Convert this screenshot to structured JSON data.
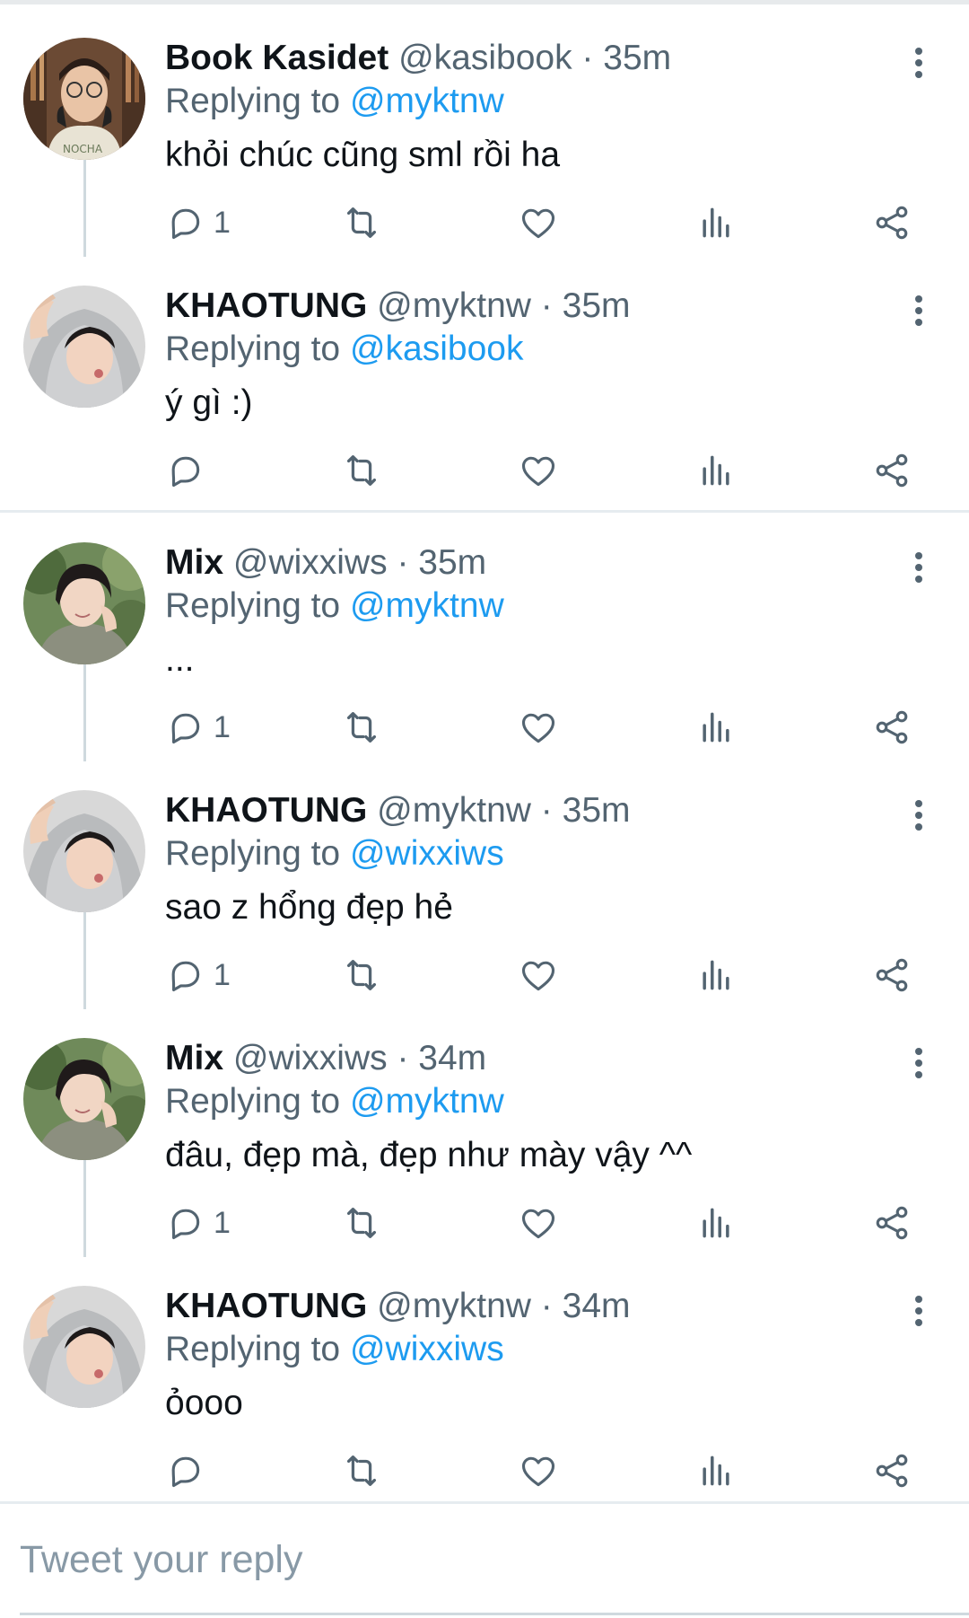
{
  "threads": [
    {
      "tweets": [
        {
          "display_name": "Book Kasidet",
          "handle": "@kasibook",
          "time": "35m",
          "replying_label": "Replying to",
          "replying_to": "@myktnw",
          "text": "khỏi chúc cũng sml rồi ha",
          "reply_count": "1",
          "avatar": "book-avatar"
        },
        {
          "display_name": "KHAOTUNG",
          "handle": "@myktnw",
          "time": "35m",
          "replying_label": "Replying to",
          "replying_to": "@kasibook",
          "text": "ý gì :)",
          "reply_count": "",
          "avatar": "khaotung-avatar"
        }
      ]
    },
    {
      "tweets": [
        {
          "display_name": "Mix",
          "handle": "@wixxiws",
          "time": "35m",
          "replying_label": "Replying to",
          "replying_to": "@myktnw",
          "text": "...",
          "reply_count": "1",
          "avatar": "mix-avatar"
        },
        {
          "display_name": "KHAOTUNG",
          "handle": "@myktnw",
          "time": "35m",
          "replying_label": "Replying to",
          "replying_to": "@wixxiws",
          "text": "sao z hổng đẹp hẻ",
          "reply_count": "1",
          "avatar": "khaotung-avatar"
        },
        {
          "display_name": "Mix",
          "handle": "@wixxiws",
          "time": "34m",
          "replying_label": "Replying to",
          "replying_to": "@myktnw",
          "text": "đâu, đẹp mà, đẹp như mày vậy ^^",
          "reply_count": "1",
          "avatar": "mix-avatar"
        },
        {
          "display_name": "KHAOTUNG",
          "handle": "@myktnw",
          "time": "34m",
          "replying_label": "Replying to",
          "replying_to": "@wixxiws",
          "text": "ỏooo",
          "reply_count": "",
          "avatar": "khaotung-avatar"
        }
      ]
    }
  ],
  "separator": "·",
  "composer": {
    "placeholder": "Tweet your reply"
  },
  "icons": {
    "reply": "reply-icon",
    "retweet": "retweet-icon",
    "like": "heart-icon",
    "views": "views-icon",
    "share": "share-icon",
    "more": "more-vertical-icon"
  },
  "colors": {
    "link": "#1d9bf0",
    "secondary_text": "#536471",
    "icon": "#536471",
    "divider": "#e6ecf0",
    "thread_line": "#cfd9de"
  }
}
